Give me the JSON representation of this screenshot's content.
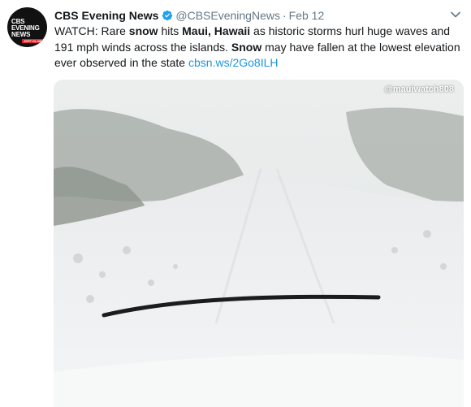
{
  "avatar": {
    "line1": "CBS",
    "line2": "EVENING",
    "line3": "NEWS",
    "tag": "JEFF GLOR"
  },
  "tweet": {
    "display_name": "CBS Evening News",
    "handle": "@CBSEveningNews",
    "separator": "·",
    "date": "Feb 12",
    "text_parts": {
      "p1": "WATCH: Rare ",
      "b1": "snow",
      "p2": " hits ",
      "b2": "Maui, Hawaii",
      "p3": " as historic storms hurl huge waves and 191 mph winds across the islands. ",
      "b3": "Snow",
      "p4": " may have fallen at the lowest elevation ever observed in the state ",
      "link": "cbsn.ws/2Go8ILH"
    }
  },
  "media": {
    "watermark": "@mauiwatch808"
  },
  "colors": {
    "link": "#1b95e0",
    "verified": "#1da1f2",
    "muted": "#657786"
  },
  "icons": [
    "verified-badge-icon",
    "chevron-down-icon"
  ]
}
